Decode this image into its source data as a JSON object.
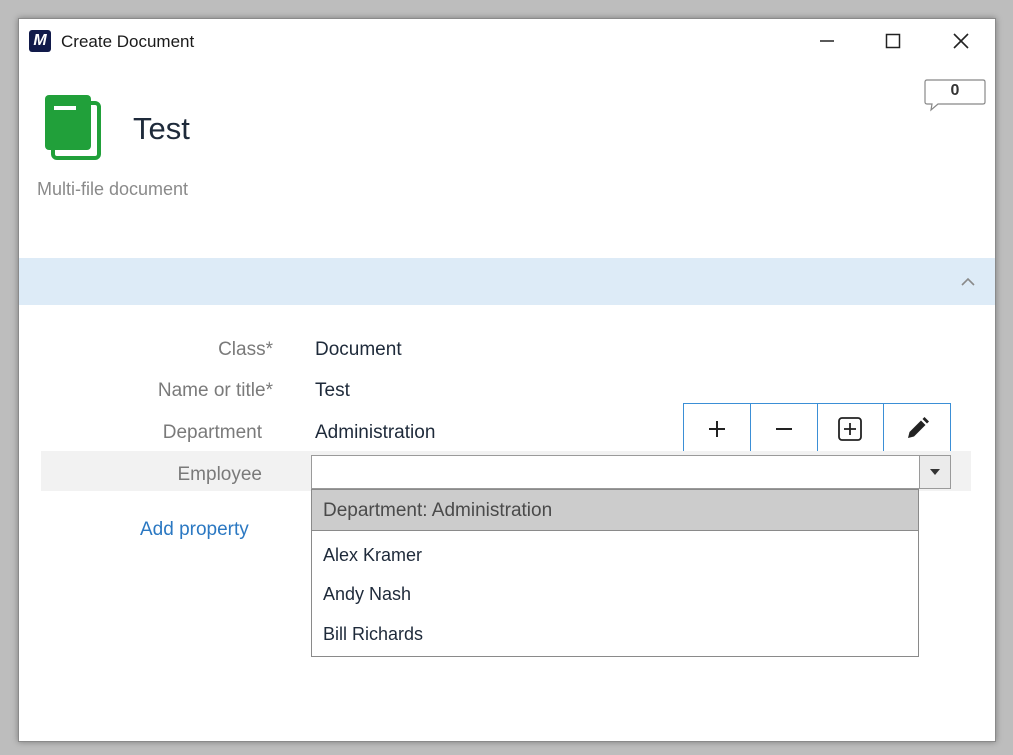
{
  "window": {
    "title": "Create Document",
    "app_logo_letter": "M",
    "comment_count": "0"
  },
  "document": {
    "title": "Test",
    "subtitle": "Multi-file document"
  },
  "properties": {
    "class_label": "Class",
    "class_value": "Document",
    "name_label": "Name or title",
    "name_value": "Test",
    "department_label": "Department",
    "department_value": "Administration",
    "employee_label": "Employee",
    "employee_value": "",
    "required_marker": "*",
    "add_property": "Add property"
  },
  "dropdown": {
    "group_header": "Department: Administration",
    "items": [
      "Alex Kramer",
      "Andy Nash",
      "Bill Richards"
    ]
  },
  "toolbar": {
    "icons": [
      "plus-icon",
      "minus-icon",
      "plus-box-icon",
      "pencil-icon"
    ]
  },
  "colors": {
    "accent": "#3b8fd6",
    "section_bar": "#ddebf7",
    "doc_icon": "#21a03a",
    "link": "#2b78c2"
  }
}
